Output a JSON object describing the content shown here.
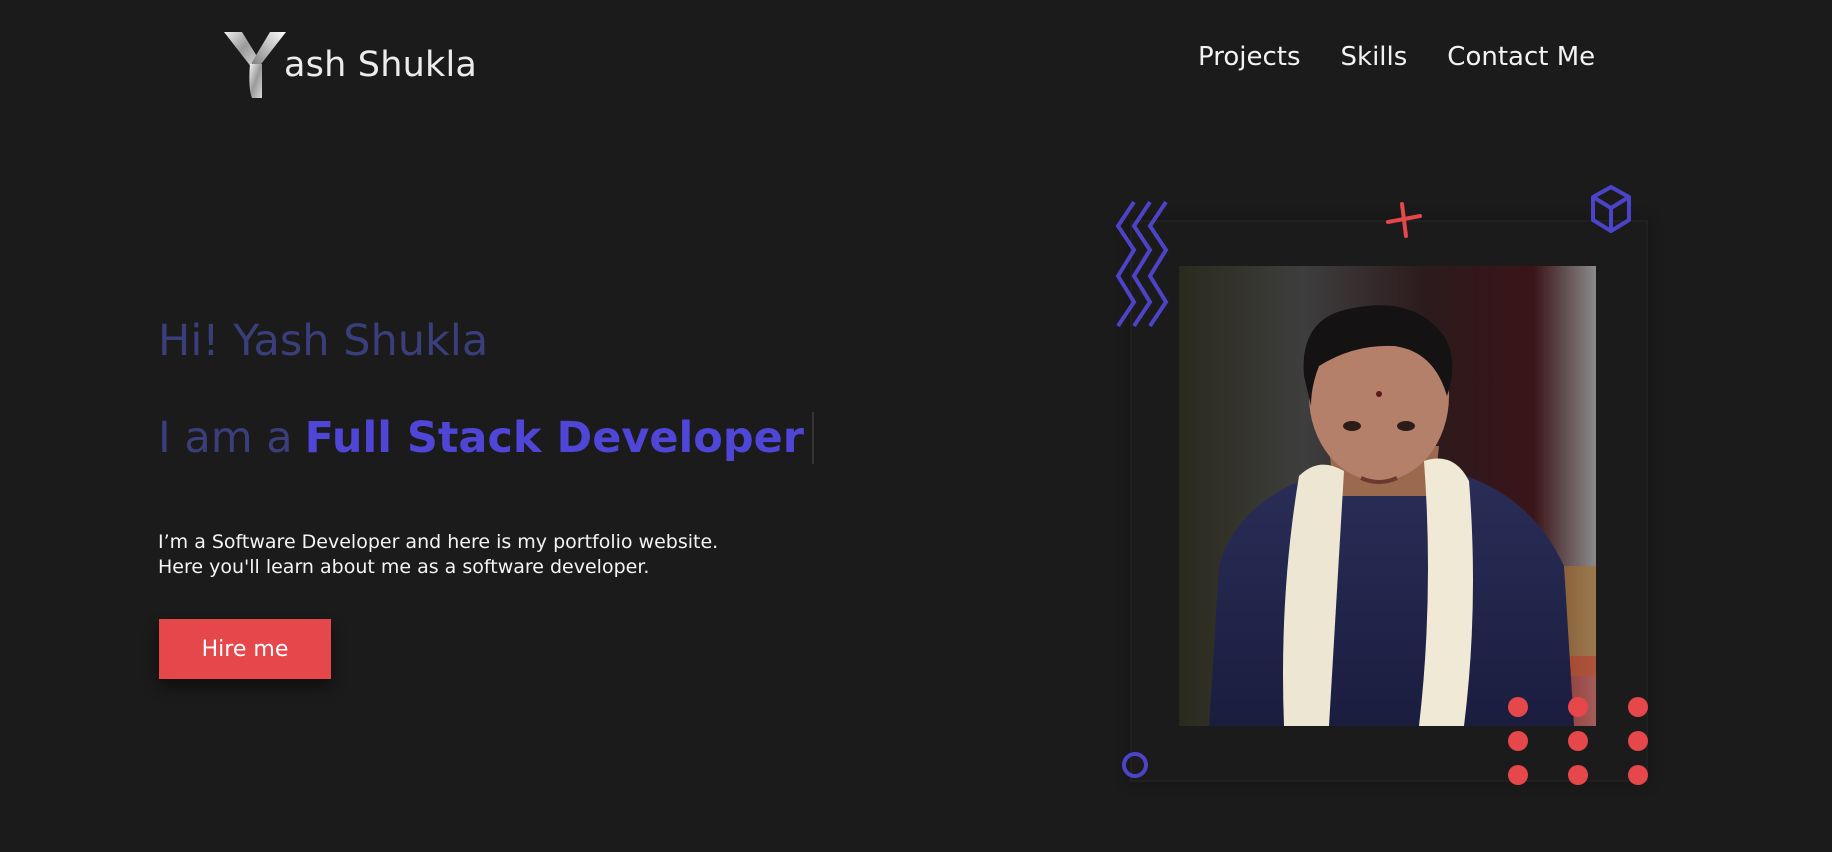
{
  "header": {
    "logo_letter": "Y",
    "logo_text": "ash Shukla",
    "nav": [
      {
        "label": "Projects"
      },
      {
        "label": "Skills"
      },
      {
        "label": "Contact Me"
      }
    ]
  },
  "hero": {
    "greeting": "Hi! Yash Shukla",
    "role_prefix": "I am a",
    "role_highlight": "Full Stack Developer",
    "intro_line1": "I’m a Software Developer and here is my portfolio website.",
    "intro_line2": "Here you'll learn about me as a software developer.",
    "cta_label": "Hire me"
  },
  "colors": {
    "background": "#1b1b1b",
    "accent_red": "#e6474a",
    "accent_purple": "#4f46d8",
    "muted_purple": "#3a3f7c"
  },
  "decorations": {
    "zigzag": "zigzag-lines-icon",
    "cross": "cross-icon",
    "cube": "cube-icon",
    "ring": "ring-icon",
    "dots": "dot-grid"
  }
}
